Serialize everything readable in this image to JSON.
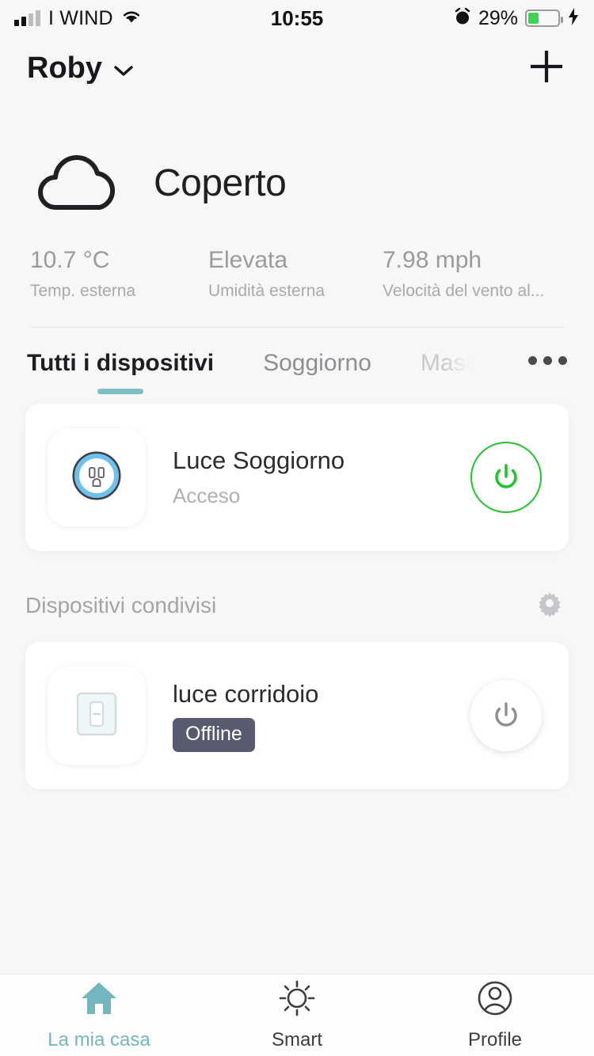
{
  "status_bar": {
    "carrier": "I WIND",
    "time": "10:55",
    "battery_percent": "29%",
    "battery_level": 35,
    "signal_bars_filled": 2,
    "icons": [
      "signal-bars-icon",
      "wifi-icon",
      "alarm-clock-icon",
      "battery-icon",
      "charging-bolt-icon"
    ]
  },
  "header": {
    "home_name": "Roby",
    "dropdown_icon": "chevron-down-icon",
    "add_icon": "plus-icon"
  },
  "weather": {
    "condition_icon": "cloud-icon",
    "condition": "Coperto",
    "stats": [
      {
        "value": "10.7 °C",
        "label": "Temp. esterna"
      },
      {
        "value": "Elevata",
        "label": "Umidità esterna"
      },
      {
        "value": "7.98 mph",
        "label": "Velocità del vento al..."
      }
    ]
  },
  "tabs": {
    "items": [
      {
        "label": "Tutti i dispositivi",
        "active": true
      },
      {
        "label": "Soggiorno",
        "active": false
      },
      {
        "label": "Mast",
        "active": false,
        "faded": true
      }
    ],
    "more_icon": "ellipsis-icon",
    "active_color": "#7fbfc4"
  },
  "devices": [
    {
      "name": "Luce Soggiorno",
      "status": "Acceso",
      "icon": "smart-plug-icon",
      "power_state": "on",
      "power_icon": "power-icon",
      "power_color": "#22c32e"
    }
  ],
  "shared_section": {
    "title": "Dispositivi condivisi",
    "settings_icon": "gear-icon",
    "devices": [
      {
        "name": "luce corridoio",
        "badge": "Offline",
        "badge_color": "#585a6e",
        "icon": "light-switch-icon",
        "power_state": "off",
        "power_icon": "power-icon",
        "power_color": "#8e8e93"
      }
    ]
  },
  "bottom_nav": {
    "items": [
      {
        "label": "La mia casa",
        "icon": "home-icon",
        "active": true
      },
      {
        "label": "Smart",
        "icon": "sun-icon",
        "active": false
      },
      {
        "label": "Profile",
        "icon": "user-circle-icon",
        "active": false
      }
    ],
    "active_color": "#74b6bd"
  }
}
